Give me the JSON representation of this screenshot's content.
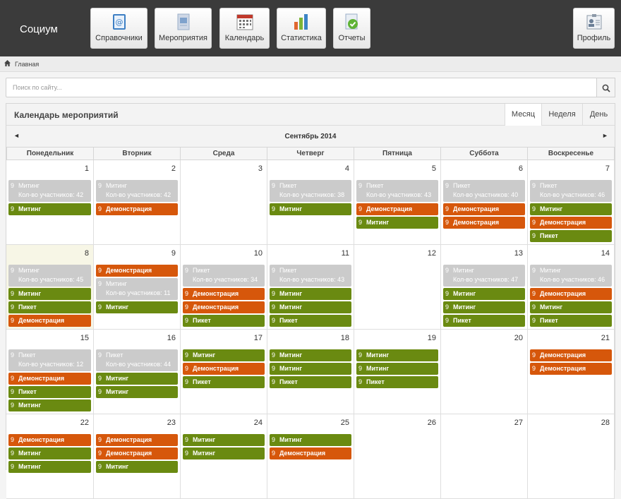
{
  "app": {
    "brand": "Социум",
    "nav": [
      {
        "label": "Справочники",
        "icon": "address-book-icon"
      },
      {
        "label": "Мероприятия",
        "icon": "document-icon"
      },
      {
        "label": "Календарь",
        "icon": "calendar-icon"
      },
      {
        "label": "Статистика",
        "icon": "bar-chart-icon"
      },
      {
        "label": "Отчеты",
        "icon": "report-check-icon"
      }
    ],
    "profile": {
      "label": "Профиль",
      "icon": "profile-card-icon"
    }
  },
  "breadcrumb": {
    "home": "Главная"
  },
  "search": {
    "placeholder": "Поиск по сайту..."
  },
  "calendar": {
    "title": "Календарь мероприятий",
    "views": [
      "Месяц",
      "Неделя",
      "День"
    ],
    "active_view": "Месяц",
    "month": "Сентябрь 2014",
    "prev": "◄",
    "next": "►",
    "weekdays": [
      "Понедельник",
      "Вторник",
      "Среда",
      "Четверг",
      "Пятница",
      "Суббота",
      "Воскресенье"
    ],
    "count_label": "Кол-во участников:",
    "today": 8,
    "weeks": [
      [
        {
          "day": 1,
          "events": [
            {
              "t": "Митинг",
              "s": "gray",
              "c": 42
            },
            {
              "t": "Митинг",
              "s": "green"
            }
          ]
        },
        {
          "day": 2,
          "events": [
            {
              "t": "Митинг",
              "s": "gray",
              "c": 42
            },
            {
              "t": "Демонстрация",
              "s": "orange"
            }
          ]
        },
        {
          "day": 3,
          "events": []
        },
        {
          "day": 4,
          "events": [
            {
              "t": "Пикет",
              "s": "gray",
              "c": 38
            },
            {
              "t": "Митинг",
              "s": "green"
            }
          ]
        },
        {
          "day": 5,
          "events": [
            {
              "t": "Пикет",
              "s": "gray",
              "c": 43
            },
            {
              "t": "Демонстрация",
              "s": "orange"
            },
            {
              "t": "Митинг",
              "s": "green"
            }
          ]
        },
        {
          "day": 6,
          "events": [
            {
              "t": "Пикет",
              "s": "gray",
              "c": 40
            },
            {
              "t": "Демонстрация",
              "s": "orange"
            },
            {
              "t": "Демонстрация",
              "s": "orange"
            }
          ]
        },
        {
          "day": 7,
          "events": [
            {
              "t": "Пикет",
              "s": "gray",
              "c": 46
            },
            {
              "t": "Митинг",
              "s": "green"
            },
            {
              "t": "Демонстрация",
              "s": "orange"
            },
            {
              "t": "Пикет",
              "s": "green"
            }
          ]
        }
      ],
      [
        {
          "day": 8,
          "events": [
            {
              "t": "Митинг",
              "s": "gray",
              "c": 45
            },
            {
              "t": "Митинг",
              "s": "green"
            },
            {
              "t": "Пикет",
              "s": "green"
            },
            {
              "t": "Демонстрация",
              "s": "orange"
            }
          ]
        },
        {
          "day": 9,
          "events": [
            {
              "t": "Демонстрация",
              "s": "orange"
            },
            {
              "t": "Митинг",
              "s": "gray",
              "c": 11
            },
            {
              "t": "Митинг",
              "s": "green"
            }
          ]
        },
        {
          "day": 10,
          "events": [
            {
              "t": "Пикет",
              "s": "gray",
              "c": 34
            },
            {
              "t": "Демонстрация",
              "s": "orange"
            },
            {
              "t": "Демонстрация",
              "s": "orange"
            },
            {
              "t": "Пикет",
              "s": "green"
            }
          ]
        },
        {
          "day": 11,
          "events": [
            {
              "t": "Пикет",
              "s": "gray",
              "c": 43
            },
            {
              "t": "Митинг",
              "s": "green"
            },
            {
              "t": "Митинг",
              "s": "green"
            },
            {
              "t": "Пикет",
              "s": "green"
            }
          ]
        },
        {
          "day": 12,
          "events": []
        },
        {
          "day": 13,
          "events": [
            {
              "t": "Митинг",
              "s": "gray",
              "c": 47
            },
            {
              "t": "Митинг",
              "s": "green"
            },
            {
              "t": "Митинг",
              "s": "green"
            },
            {
              "t": "Пикет",
              "s": "green"
            }
          ]
        },
        {
          "day": 14,
          "events": [
            {
              "t": "Митинг",
              "s": "gray",
              "c": 46
            },
            {
              "t": "Демонстрация",
              "s": "orange"
            },
            {
              "t": "Митинг",
              "s": "green"
            },
            {
              "t": "Пикет",
              "s": "green"
            }
          ]
        }
      ],
      [
        {
          "day": 15,
          "events": [
            {
              "t": "Пикет",
              "s": "gray",
              "c": 12
            },
            {
              "t": "Демонстрация",
              "s": "orange"
            },
            {
              "t": "Пикет",
              "s": "green"
            },
            {
              "t": "Митинг",
              "s": "green"
            }
          ]
        },
        {
          "day": 16,
          "events": [
            {
              "t": "Пикет",
              "s": "gray",
              "c": 44
            },
            {
              "t": "Митинг",
              "s": "green"
            },
            {
              "t": "Митинг",
              "s": "green"
            }
          ]
        },
        {
          "day": 17,
          "events": [
            {
              "t": "Митинг",
              "s": "green"
            },
            {
              "t": "Демонстрация",
              "s": "orange"
            },
            {
              "t": "Пикет",
              "s": "green"
            }
          ]
        },
        {
          "day": 18,
          "events": [
            {
              "t": "Митинг",
              "s": "green"
            },
            {
              "t": "Митинг",
              "s": "green"
            },
            {
              "t": "Пикет",
              "s": "green"
            }
          ]
        },
        {
          "day": 19,
          "events": [
            {
              "t": "Митинг",
              "s": "green"
            },
            {
              "t": "Митинг",
              "s": "green"
            },
            {
              "t": "Пикет",
              "s": "green"
            }
          ]
        },
        {
          "day": 20,
          "events": []
        },
        {
          "day": 21,
          "events": [
            {
              "t": "Демонстрация",
              "s": "orange"
            },
            {
              "t": "Демонстрация",
              "s": "orange"
            }
          ]
        }
      ],
      [
        {
          "day": 22,
          "events": [
            {
              "t": "Демонстрация",
              "s": "orange"
            },
            {
              "t": "Митинг",
              "s": "green"
            },
            {
              "t": "Митинг",
              "s": "green"
            }
          ]
        },
        {
          "day": 23,
          "events": [
            {
              "t": "Демонстрация",
              "s": "orange"
            },
            {
              "t": "Демонстрация",
              "s": "orange"
            },
            {
              "t": "Митинг",
              "s": "green"
            }
          ]
        },
        {
          "day": 24,
          "events": [
            {
              "t": "Митинг",
              "s": "green"
            },
            {
              "t": "Митинг",
              "s": "green"
            }
          ]
        },
        {
          "day": 25,
          "events": [
            {
              "t": "Митинг",
              "s": "green"
            },
            {
              "t": "Демонстрация",
              "s": "orange"
            }
          ]
        },
        {
          "day": 26,
          "events": []
        },
        {
          "day": 27,
          "events": []
        },
        {
          "day": 28,
          "events": []
        }
      ]
    ],
    "event_time": "9"
  },
  "colors": {
    "green": "#6a8a11",
    "orange": "#d6570b",
    "gray": "#cbcbcb",
    "topbar": "#3b3b3b",
    "today": "#f7f6e6"
  }
}
